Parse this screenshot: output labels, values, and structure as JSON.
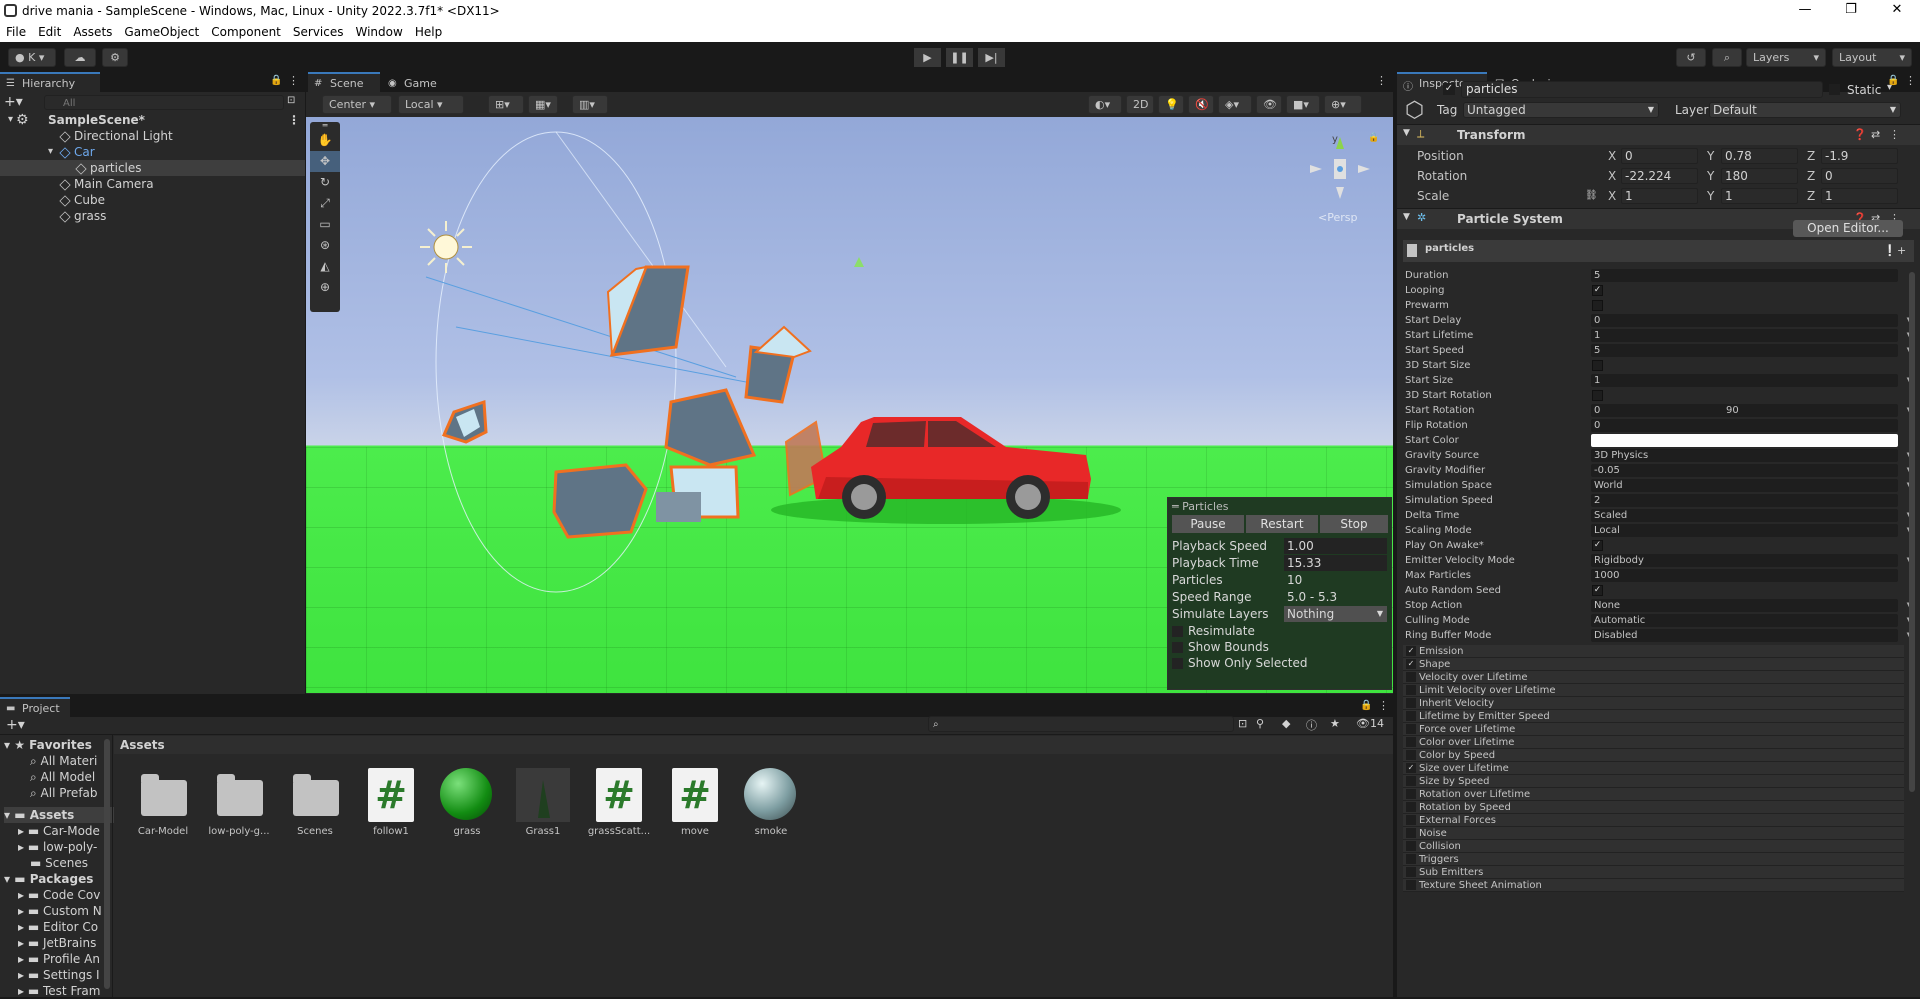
{
  "window": {
    "title": "drive mania - SampleScene - Windows, Mac, Linux - Unity 2022.3.7f1* <DX11>",
    "min": "—",
    "max": "❐",
    "close": "✕"
  },
  "menu": [
    "File",
    "Edit",
    "Assets",
    "GameObject",
    "Component",
    "Services",
    "Window",
    "Help"
  ],
  "toolbar": {
    "account": "K",
    "layers": "Layers",
    "layout": "Layout"
  },
  "hierarchy": {
    "tab": "Hierarchy",
    "search_placeholder": "All",
    "scene": "SampleScene*",
    "items": [
      "Directional Light",
      "Car",
      "particles",
      "Main Camera",
      "Cube",
      "grass"
    ]
  },
  "scene_view": {
    "tab_scene": "Scene",
    "tab_game": "Game",
    "pivot": "Center",
    "space": "Local",
    "mode_2d": "2D",
    "persp": "<Persp",
    "gizmo_y": "y"
  },
  "particles_overlay": {
    "title": "Particles",
    "pause": "Pause",
    "restart": "Restart",
    "stop": "Stop",
    "rows": [
      {
        "label": "Playback Speed",
        "value": "1.00"
      },
      {
        "label": "Playback Time",
        "value": "15.33"
      },
      {
        "label": "Particles",
        "value": "10"
      },
      {
        "label": "Speed Range",
        "value": "5.0 - 5.3"
      },
      {
        "label": "Simulate Layers",
        "value": "Nothing"
      }
    ],
    "checks": [
      "Resimulate",
      "Show Bounds",
      "Show Only Selected"
    ]
  },
  "inspector": {
    "tab": "Inspector",
    "tab2": "Occlusion",
    "object_name": "particles",
    "static": "Static",
    "tag_label": "Tag",
    "tag": "Untagged",
    "layer_label": "Layer",
    "layer": "Default",
    "transform": {
      "title": "Transform",
      "position": {
        "label": "Position",
        "x": "0",
        "y": "0.78",
        "z": "-1.9"
      },
      "rotation": {
        "label": "Rotation",
        "x": "-22.224",
        "y": "180",
        "z": "0"
      },
      "scale": {
        "label": "Scale",
        "x": "1",
        "y": "1",
        "z": "1"
      }
    },
    "ps_title": "Particle System",
    "open_editor": "Open Editor...",
    "ps_name": "particles",
    "props": [
      {
        "label": "Duration",
        "value": "5",
        "kind": "field"
      },
      {
        "label": "Looping",
        "value": "✓",
        "kind": "check"
      },
      {
        "label": "Prewarm",
        "value": "",
        "kind": "check"
      },
      {
        "label": "Start Delay",
        "value": "0",
        "kind": "dd"
      },
      {
        "label": "Start Lifetime",
        "value": "1",
        "kind": "dd"
      },
      {
        "label": "Start Speed",
        "value": "5",
        "kind": "dd"
      },
      {
        "label": "3D Start Size",
        "value": "",
        "kind": "check"
      },
      {
        "label": "Start Size",
        "value": "1",
        "kind": "dd"
      },
      {
        "label": "3D Start Rotation",
        "value": "",
        "kind": "check"
      },
      {
        "label": "Start Rotation",
        "value": "0",
        "value2": "90",
        "kind": "range"
      },
      {
        "label": "Flip Rotation",
        "value": "0",
        "kind": "field"
      },
      {
        "label": "Start Color",
        "value": "",
        "kind": "color"
      },
      {
        "label": "Gravity Source",
        "value": "3D Physics",
        "kind": "dd"
      },
      {
        "label": "Gravity Modifier",
        "value": "-0.05",
        "kind": "dd"
      },
      {
        "label": "Simulation Space",
        "value": "World",
        "kind": "dd"
      },
      {
        "label": "Simulation Speed",
        "value": "2",
        "kind": "field"
      },
      {
        "label": "Delta Time",
        "value": "Scaled",
        "kind": "dd"
      },
      {
        "label": "Scaling Mode",
        "value": "Local",
        "kind": "dd"
      },
      {
        "label": "Play On Awake*",
        "value": "✓",
        "kind": "check"
      },
      {
        "label": "Emitter Velocity Mode",
        "value": "Rigidbody",
        "kind": "dd"
      },
      {
        "label": "Max Particles",
        "value": "1000",
        "kind": "field"
      },
      {
        "label": "Auto Random Seed",
        "value": "✓",
        "kind": "check"
      },
      {
        "label": "Stop Action",
        "value": "None",
        "kind": "dd"
      },
      {
        "label": "Culling Mode",
        "value": "Automatic",
        "kind": "dd"
      },
      {
        "label": "Ring Buffer Mode",
        "value": "Disabled",
        "kind": "dd"
      }
    ],
    "modules": [
      {
        "label": "Emission",
        "on": "✓"
      },
      {
        "label": "Shape",
        "on": "✓"
      },
      {
        "label": "Velocity over Lifetime",
        "on": ""
      },
      {
        "label": "Limit Velocity over Lifetime",
        "on": ""
      },
      {
        "label": "Inherit Velocity",
        "on": ""
      },
      {
        "label": "Lifetime by Emitter Speed",
        "on": ""
      },
      {
        "label": "Force over Lifetime",
        "on": ""
      },
      {
        "label": "Color over Lifetime",
        "on": ""
      },
      {
        "label": "Color by Speed",
        "on": ""
      },
      {
        "label": "Size over Lifetime",
        "on": "✓"
      },
      {
        "label": "Size by Speed",
        "on": ""
      },
      {
        "label": "Rotation over Lifetime",
        "on": ""
      },
      {
        "label": "Rotation by Speed",
        "on": ""
      },
      {
        "label": "External Forces",
        "on": ""
      },
      {
        "label": "Noise",
        "on": ""
      },
      {
        "label": "Collision",
        "on": ""
      },
      {
        "label": "Triggers",
        "on": ""
      },
      {
        "label": "Sub Emitters",
        "on": ""
      },
      {
        "label": "Texture Sheet Animation",
        "on": ""
      }
    ]
  },
  "project": {
    "tab": "Project",
    "breadcrumb": "Assets",
    "count": "14",
    "favorites": {
      "label": "Favorites",
      "items": [
        "All Materi",
        "All Model",
        "All Prefab"
      ]
    },
    "assets_tree": {
      "label": "Assets",
      "items": [
        "Car-Mode",
        "low-poly-",
        "Scenes"
      ]
    },
    "packages": {
      "label": "Packages",
      "items": [
        "Code Cov",
        "Custom N",
        "Editor Co",
        "JetBrains",
        "Profile An",
        "Settings I",
        "Test Fram"
      ]
    },
    "assets": [
      {
        "name": "Car-Model",
        "kind": "folder"
      },
      {
        "name": "low-poly-g...",
        "kind": "folder"
      },
      {
        "name": "Scenes",
        "kind": "folder"
      },
      {
        "name": "follow1",
        "kind": "script"
      },
      {
        "name": "grass",
        "kind": "green"
      },
      {
        "name": "Grass1",
        "kind": "mesh"
      },
      {
        "name": "grassScatt...",
        "kind": "script"
      },
      {
        "name": "move",
        "kind": "script"
      },
      {
        "name": "smoke",
        "kind": "grey"
      }
    ]
  }
}
